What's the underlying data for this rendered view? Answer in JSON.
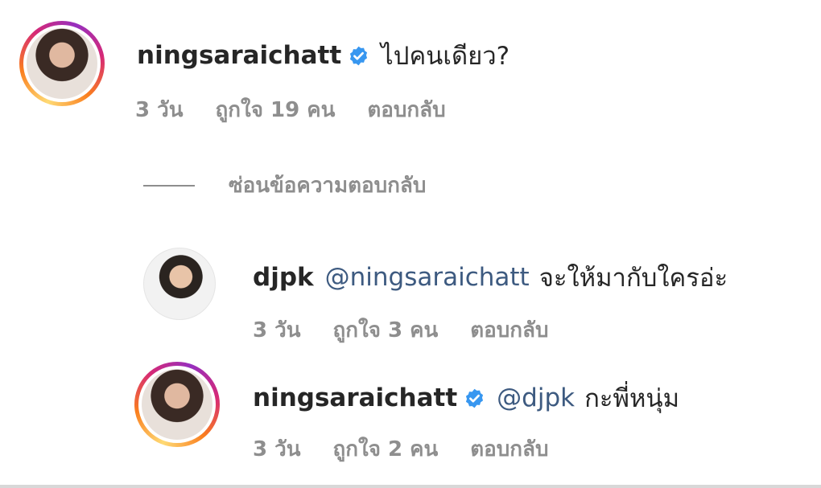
{
  "comments": [
    {
      "username": "ningsaraichatt",
      "verified": true,
      "mention": "",
      "text": "ไปคนเดียว?",
      "time": "3 วัน",
      "likes": "ถูกใจ 19 คน",
      "reply": "ตอบกลับ"
    }
  ],
  "hide_replies": "ซ่อนข้อความตอบกลับ",
  "replies": [
    {
      "username": "djpk",
      "verified": false,
      "mention": "@ningsaraichatt",
      "text": "จะให้มากับใครอ่ะ",
      "time": "3 วัน",
      "likes": "ถูกใจ 3 คน",
      "reply": "ตอบกลับ"
    },
    {
      "username": "ningsaraichatt",
      "verified": true,
      "mention": "@djpk",
      "text": "กะพี่หนุ่ม",
      "time": "3 วัน",
      "likes": "ถูกใจ 2 คน",
      "reply": "ตอบกลับ"
    }
  ],
  "colors": {
    "verified": "#3897f0",
    "mention": "#3d5a80",
    "meta": "#8e8e8e"
  }
}
